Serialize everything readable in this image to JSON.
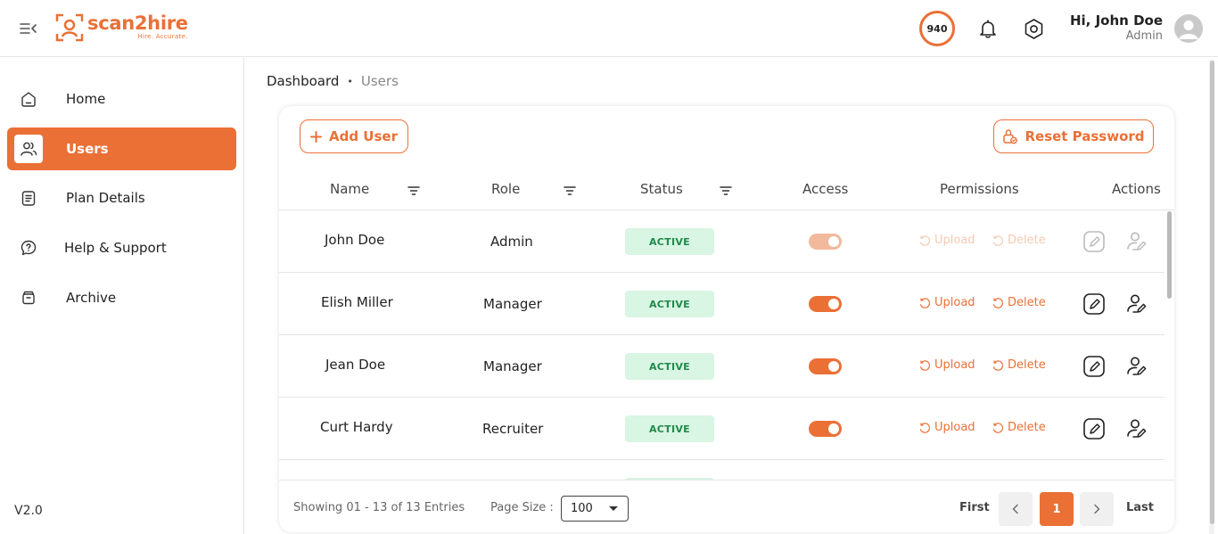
{
  "brand": {
    "name": "scan2hire",
    "tagline": "Hire. Accurate.",
    "accent_color": "#ea7036"
  },
  "header": {
    "credits": "940",
    "greeting": "Hi, John Doe",
    "role": "Admin",
    "icons": [
      "menu-collapse-icon",
      "bell-icon",
      "settings-icon",
      "user-avatar-icon"
    ]
  },
  "sidebar": {
    "items": [
      {
        "label": "Home",
        "icon": "home-icon",
        "active": false
      },
      {
        "label": "Users",
        "icon": "users-icon",
        "active": true
      },
      {
        "label": "Plan Details",
        "icon": "plan-icon",
        "active": false
      },
      {
        "label": "Help & Support",
        "icon": "help-icon",
        "active": false
      },
      {
        "label": "Archive",
        "icon": "archive-icon",
        "active": false
      }
    ],
    "version": "V2.0"
  },
  "breadcrumb": {
    "home": "Dashboard",
    "separator": "•",
    "current": "Users"
  },
  "toolbar": {
    "add_label": "Add User",
    "reset_label": "Reset Password"
  },
  "table": {
    "columns": [
      "Name",
      "Role",
      "Status",
      "Access",
      "Permissions",
      "Actions"
    ],
    "upload_label": "Upload",
    "delete_label": "Delete",
    "rows": [
      {
        "name": "John Doe",
        "role": "Admin",
        "status": "ACTIVE",
        "access": true,
        "editable": false
      },
      {
        "name": "Elish Miller",
        "role": "Manager",
        "status": "ACTIVE",
        "access": true,
        "editable": true
      },
      {
        "name": "Jean Doe",
        "role": "Manager",
        "status": "ACTIVE",
        "access": true,
        "editable": true
      },
      {
        "name": "Curt Hardy",
        "role": "Recruiter",
        "status": "ACTIVE",
        "access": true,
        "editable": true
      }
    ]
  },
  "footer": {
    "showing": "Showing 01 - 13 of 13 Entries",
    "page_size_label": "Page Size :",
    "page_size_value": "100",
    "first_label": "First",
    "last_label": "Last",
    "current_page": "1"
  }
}
